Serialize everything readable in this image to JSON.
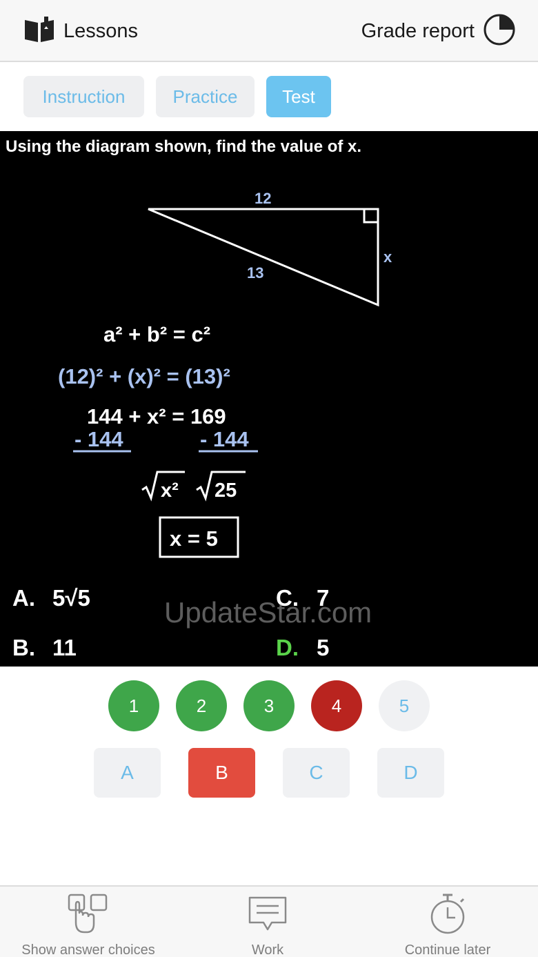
{
  "header": {
    "lessons_label": "Lessons",
    "lessons_icon": "open-book-icon",
    "grade_label": "Grade report",
    "grade_icon": "pie-progress-icon"
  },
  "tabs": [
    {
      "label": "Instruction",
      "active": false
    },
    {
      "label": "Practice",
      "active": false
    },
    {
      "label": "Test",
      "active": true
    }
  ],
  "question": {
    "prompt": "Using the diagram shown, find the value of x.",
    "diagram": {
      "top_label": "12",
      "hypotenuse_label": "13",
      "side_label": "x"
    },
    "steps": {
      "line1": "a² + b² = c²",
      "line2": "(12)² + (x)² = (13)²",
      "line3": "144 + x² = 169",
      "sub_left": "- 144",
      "sub_right": "- 144",
      "line4_left": "x²",
      "line4_right": "25",
      "boxed": "x = 5"
    },
    "choices": [
      {
        "letter": "A.",
        "text": "5√5"
      },
      {
        "letter": "C.",
        "text": "7"
      },
      {
        "letter": "B.",
        "text": "11"
      },
      {
        "letter": "D.",
        "text": "5",
        "highlighted": true
      }
    ],
    "watermark": "UpdateStar.com"
  },
  "colors": {
    "accent_blue": "#6cc4f0",
    "correct_green": "#3fa64a",
    "wrong_red": "#b9241f",
    "selected_answer": "#e24c3e",
    "diagram_blue": "#a9c2f0",
    "choice_d_green": "#5ad34a"
  },
  "question_nav": [
    {
      "label": "1",
      "status": "correct"
    },
    {
      "label": "2",
      "status": "correct"
    },
    {
      "label": "3",
      "status": "correct"
    },
    {
      "label": "4",
      "status": "wrong"
    },
    {
      "label": "5",
      "status": "current"
    }
  ],
  "answers": [
    {
      "label": "A",
      "selected": false
    },
    {
      "label": "B",
      "selected": true
    },
    {
      "label": "C",
      "selected": false
    },
    {
      "label": "D",
      "selected": false
    }
  ],
  "bottom_bar": [
    {
      "label": "Show answer choices",
      "icon": "tap-choices-icon"
    },
    {
      "label": "Work",
      "icon": "chat-note-icon"
    },
    {
      "label": "Continue later",
      "icon": "stopwatch-icon"
    }
  ]
}
